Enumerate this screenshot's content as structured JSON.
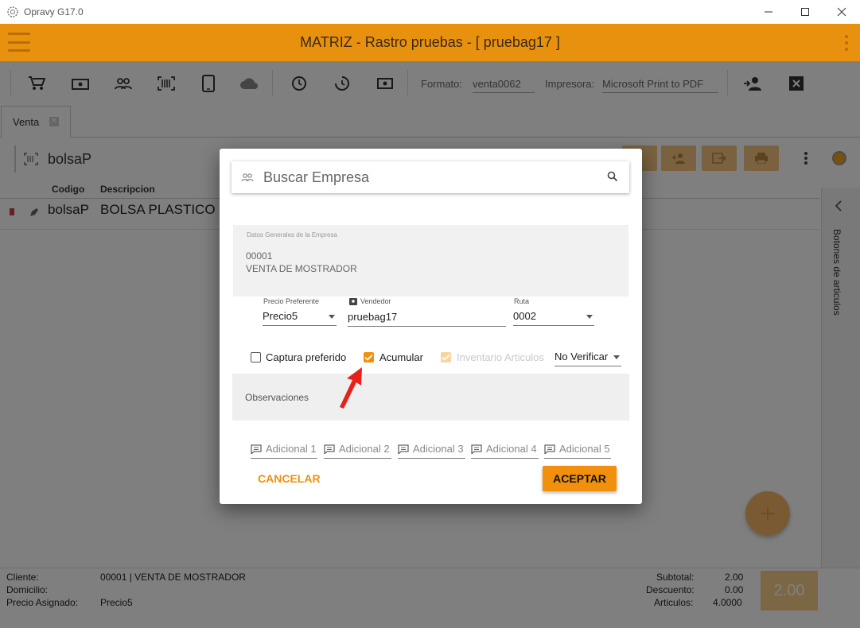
{
  "window": {
    "title": "Opravy G17.0"
  },
  "header": {
    "title": "MATRIZ - Rastro pruebas - [ pruebag17 ]"
  },
  "toolbar": {
    "formato_label": "Formato:",
    "formato_value": "venta0062",
    "impresora_label": "Impresora:",
    "impresora_value": "Microsoft Print to PDF"
  },
  "tabs": [
    {
      "label": "Venta"
    }
  ],
  "product_search": {
    "value": "bolsaP"
  },
  "grid": {
    "columns": [
      "Codigo",
      "Descripcion"
    ],
    "rows": [
      {
        "codigo": "bolsaP",
        "descripcion": "BOLSA PLASTICO"
      }
    ]
  },
  "right_panel": {
    "label": "Botones de articulos"
  },
  "footer": {
    "cliente_label": "Cliente:",
    "cliente_value": "00001 | VENTA DE MOSTRADOR",
    "domicilio_label": "Domicilio:",
    "precio_label": "Precio Asignado:",
    "precio_value": "Precio5",
    "subtotal_label": "Subtotal:",
    "subtotal_value": "2.00",
    "descuento_label": "Descuento:",
    "descuento_value": "0.00",
    "articulos_label": "Articulos:",
    "articulos_value": "4.0000",
    "total": "2.00"
  },
  "dialog": {
    "search_placeholder": "Buscar Empresa",
    "datos_label": "Datos Generales de la Empresa",
    "empresa_code": "00001",
    "empresa_name": "VENTA DE MOSTRADOR",
    "precio_label": "Precio Preferente",
    "precio_value": "Precio5",
    "vendedor_label": "Vendedor",
    "vendedor_value": "pruebag17",
    "ruta_label": "Ruta",
    "ruta_value": "0002",
    "captura_label": "Captura preferido",
    "captura_checked": false,
    "acumular_label": "Acumular",
    "acumular_checked": true,
    "inventario_label": "Inventario Articulos",
    "inventario_checked": true,
    "verificar_value": "No Verificar",
    "observaciones_placeholder": "Observaciones",
    "adicionales": [
      "Adicional 1",
      "Adicional 2",
      "Adicional 3",
      "Adicional 4",
      "Adicional 5"
    ],
    "cancel_label": "CANCELAR",
    "ok_label": "ACEPTAR"
  },
  "colors": {
    "accent": "#f0900c",
    "header": "#e8910f"
  }
}
